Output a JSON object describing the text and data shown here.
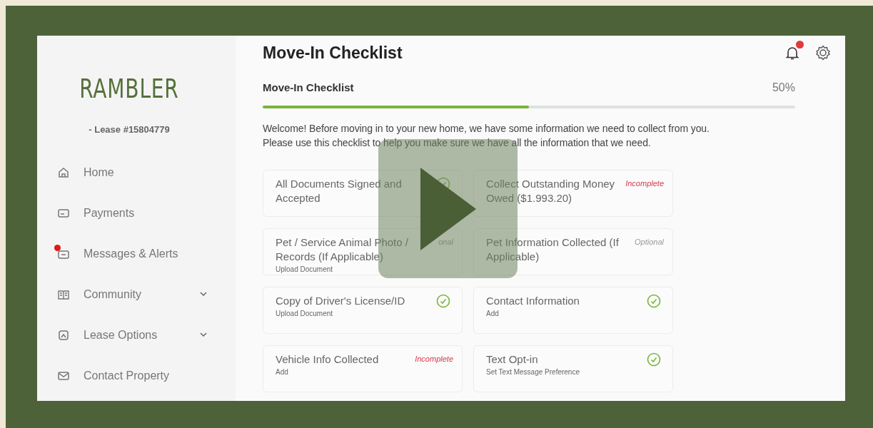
{
  "sidebar": {
    "logo": "RAMBLER",
    "lease": "- Lease #15804779",
    "items": [
      {
        "label": "Home",
        "expandable": false,
        "unread": false
      },
      {
        "label": "Payments",
        "expandable": false,
        "unread": false
      },
      {
        "label": "Messages & Alerts",
        "expandable": false,
        "unread": true
      },
      {
        "label": "Community",
        "expandable": true,
        "unread": false
      },
      {
        "label": "Lease Options",
        "expandable": true,
        "unread": false
      },
      {
        "label": "Contact Property",
        "expandable": false,
        "unread": false
      }
    ]
  },
  "header": {
    "title": "Move-In Checklist",
    "notifications_unread": true
  },
  "progress": {
    "label": "Move-In Checklist",
    "reading": "50%",
    "level": 0.5
  },
  "intro": [
    "Welcome! Before moving in to your new home, we have some information we need to collect from you.",
    "Please use this checklist to help you make sure we have all the information that we need."
  ],
  "cards": [
    {
      "title": "All Documents Signed and Accepted",
      "kind": "complete"
    },
    {
      "title": "Collect Outstanding Money Owed ($1.993.20)",
      "kind": "incomplete",
      "status": "Incomplete"
    },
    {
      "title": "Pet / Service Animal Photo / Records (If Applicable)",
      "subtitle": "Upload Document",
      "kind": "optional",
      "status": "onal"
    },
    {
      "title": "Pet Information Collected (If Applicable)",
      "kind": "optional",
      "status": "Optional"
    },
    {
      "title": "Copy of Driver's License/ID",
      "subtitle": "Upload Document",
      "kind": "complete"
    },
    {
      "title": "Contact Information",
      "subtitle": "Add",
      "kind": "complete"
    },
    {
      "title": "Vehicle Info Collected",
      "subtitle": "Add",
      "kind": "incomplete",
      "status": "Incomplete"
    },
    {
      "title": "Text Opt-in",
      "subtitle": "Set Text Message Preference",
      "kind": "complete"
    }
  ]
}
